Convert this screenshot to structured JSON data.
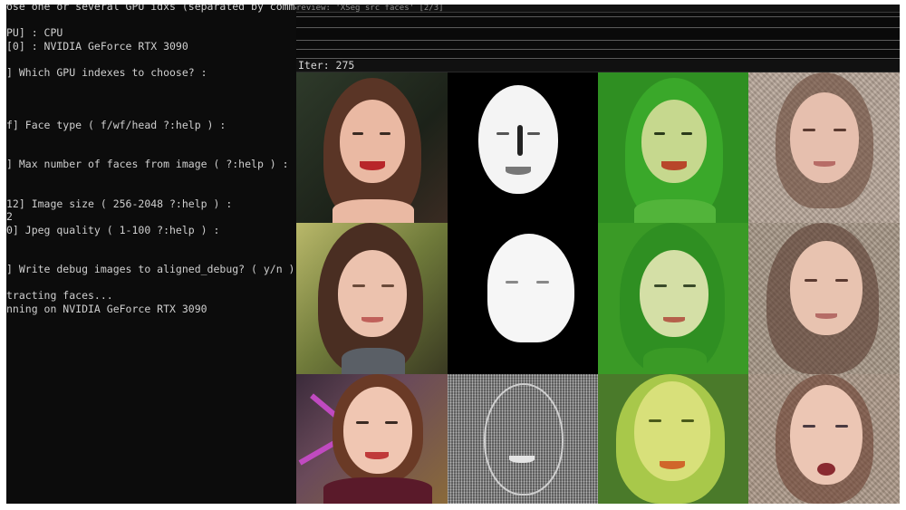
{
  "console": {
    "lines": [
      "ose one or several GPU idxs (separated by comma",
      "",
      "PU] : CPU",
      "[0] : NVIDIA GeForce RTX 3090",
      "",
      "] Which GPU indexes to choose? :",
      "",
      "",
      "",
      "f] Face type ( f/wf/head ?:help ) :",
      "",
      "",
      "] Max number of faces from image ( ?:help ) :",
      "",
      "",
      "12] Image size ( 256-2048 ?:help ) :",
      "2",
      "0] Jpeg quality ( 1-100 ?:help ) :",
      "",
      "",
      "] Write debug images to aligned_debug? ( y/n ) :",
      "",
      "tracting faces...",
      "nning on NVIDIA GeForce RTX 3090"
    ]
  },
  "preview": {
    "title": "review: 'XSeg src faces' [2/3]",
    "iter_label": "Iter: 275"
  },
  "grid": {
    "columns": [
      "source-face",
      "mask",
      "mask-overlay",
      "predicted-face"
    ],
    "rows": 3
  },
  "colors": {
    "console_bg": "#0c0c0c",
    "console_text": "#cfcfcf",
    "overlay_green": "#3fae2a",
    "skin": "#e9b8a4",
    "hair_brown": "#5a3526"
  }
}
